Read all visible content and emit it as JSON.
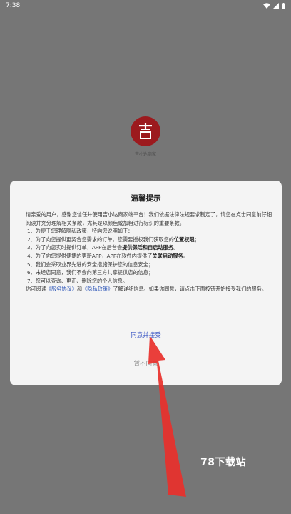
{
  "status_bar": {
    "time": "7:38"
  },
  "splash": {
    "logo_char": "吉",
    "logo_caption": "吉小达商家",
    "logo_color": "#9c1a1e"
  },
  "dialog": {
    "title": "温馨提示",
    "intro": "请亲爱的用户，感谢您信任并使用吉小达商家端平台！我们依据法律法规要求制定了，请您在点击同意前仔细阅读并充分理解相关条款，尤其是以颜色或加粗进行标识的重要条款。",
    "items": [
      {
        "text": "1、为便于您理解隐私政策，特向您说明如下：",
        "bold": ""
      },
      {
        "text": "2、为了向您提供更契合您需求的订单，您需要授权我们获取您的",
        "bold": "位置权限",
        "tail": "；"
      },
      {
        "text": "3、为了向您实时提供订单，APP在后台会",
        "bold": "提供保活和自启动服务",
        "tail": "。"
      },
      {
        "text": "4、为了向您提供便捷的更新APP，APP在软件内提供了",
        "bold": "关联启动服务",
        "tail": "。"
      },
      {
        "text": "5、我们会采取业界先进的安全措施保护您的信息安全；",
        "bold": ""
      },
      {
        "text": "6、未经您同意，我们不会向第三方共享提供您的信息；",
        "bold": ""
      },
      {
        "text": "7、您可以查询、更正、删除您的个人信息。",
        "bold": ""
      }
    ],
    "outro_prefix": "你可阅读",
    "service_link": "《服务协议》",
    "outro_and": "和",
    "privacy_link": "《隐私政策》",
    "outro_suffix": "了解详细信息。如果你同意，请点击下面按钮开始接受我们的服务。",
    "agree_label": "同意并接受",
    "disagree_label": "暂不同意"
  },
  "watermark": {
    "text": "78下载站"
  },
  "colors": {
    "overlay": "#767676",
    "dialog_bg": "#f4f4f4",
    "link": "#2f57b8",
    "arrow": "#e8302c"
  }
}
